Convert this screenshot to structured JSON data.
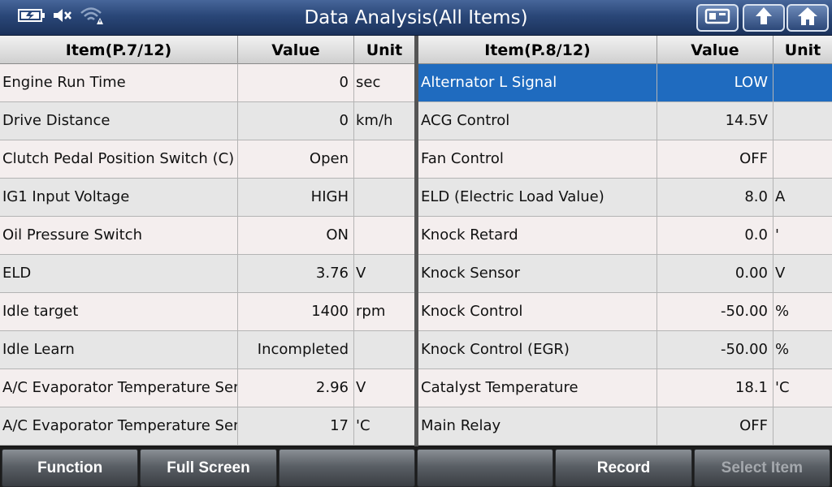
{
  "title": "Data Analysis(All Items)",
  "left_table": {
    "headers": {
      "item": "Item(P.7/12)",
      "value": "Value",
      "unit": "Unit"
    },
    "rows": [
      {
        "item": "Engine Run Time",
        "value": "0",
        "unit": "sec"
      },
      {
        "item": "Drive Distance",
        "value": "0",
        "unit": "km/h"
      },
      {
        "item": "Clutch Pedal Position Switch (C)",
        "value": "Open",
        "unit": ""
      },
      {
        "item": "IG1 Input Voltage",
        "value": "HIGH",
        "unit": ""
      },
      {
        "item": "Oil Pressure Switch",
        "value": "ON",
        "unit": ""
      },
      {
        "item": "ELD",
        "value": "3.76",
        "unit": "V"
      },
      {
        "item": "Idle target",
        "value": "1400",
        "unit": "rpm"
      },
      {
        "item": "Idle Learn",
        "value": "Incompleted",
        "unit": ""
      },
      {
        "item": "A/C Evaporator Temperature Sensor",
        "value": "2.96",
        "unit": "V"
      },
      {
        "item": "A/C Evaporator Temperature Sensor",
        "value": "17",
        "unit": "'C"
      }
    ]
  },
  "right_table": {
    "headers": {
      "item": "Item(P.8/12)",
      "value": "Value",
      "unit": "Unit"
    },
    "rows": [
      {
        "item": "Alternator L Signal",
        "value": "LOW",
        "unit": ""
      },
      {
        "item": "ACG Control",
        "value": "14.5V",
        "unit": ""
      },
      {
        "item": "Fan Control",
        "value": "OFF",
        "unit": ""
      },
      {
        "item": "ELD (Electric Load Value)",
        "value": "8.0",
        "unit": "A"
      },
      {
        "item": "Knock Retard",
        "value": "0.0",
        "unit": "'"
      },
      {
        "item": "Knock Sensor",
        "value": "0.00",
        "unit": "V"
      },
      {
        "item": "Knock Control",
        "value": "-50.00",
        "unit": "%"
      },
      {
        "item": "Knock Control (EGR)",
        "value": "-50.00",
        "unit": "%"
      },
      {
        "item": "Catalyst Temperature",
        "value": "18.1",
        "unit": "'C"
      },
      {
        "item": "Main Relay",
        "value": "OFF",
        "unit": ""
      }
    ]
  },
  "toolbar": {
    "function_label": "Function",
    "fullscreen_label": "Full Screen",
    "blank1_label": "",
    "blank2_label": "",
    "record_label": "Record",
    "select_item_label": "Select Item"
  },
  "icons": {
    "battery": "battery-icon",
    "mute": "speaker-mute-icon",
    "wifi": "wifi-warning-icon",
    "screenshot": "screenshot-icon",
    "back": "back-arrow-icon",
    "home": "home-icon"
  },
  "colors": {
    "titlebar": "#2a4778",
    "selected_row": "#1f6bbf"
  }
}
